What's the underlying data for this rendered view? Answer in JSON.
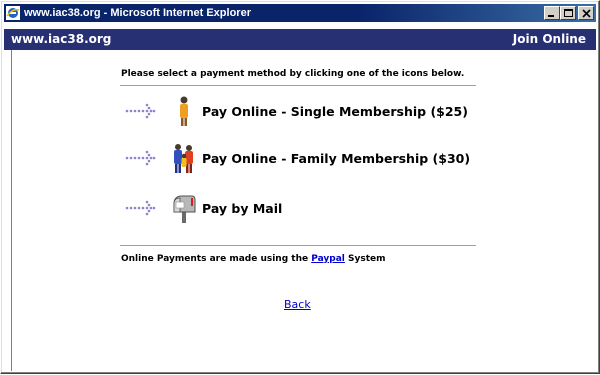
{
  "window": {
    "title": "www.iac38.org - Microsoft Internet Explorer",
    "buttons": [
      "minimize",
      "maximize",
      "close"
    ]
  },
  "header": {
    "site_name": "www.iac38.org",
    "join_label": "Join Online"
  },
  "instructions": "Please select a payment method by clicking one of the icons below.",
  "options": [
    {
      "label": "Pay Online - Single Membership ($25)",
      "icon": "single-person-icon"
    },
    {
      "label": "Pay Online - Family Membership ($30)",
      "icon": "family-icon"
    },
    {
      "label": "Pay by Mail",
      "icon": "mailbox-icon"
    }
  ],
  "footer": {
    "prefix": "Online Payments are made using the ",
    "link": "Paypal",
    "suffix": " System"
  },
  "back_label": "Back",
  "colors": {
    "titlebar": "#0a246a",
    "header": "#283074",
    "link": "#0000cc"
  }
}
